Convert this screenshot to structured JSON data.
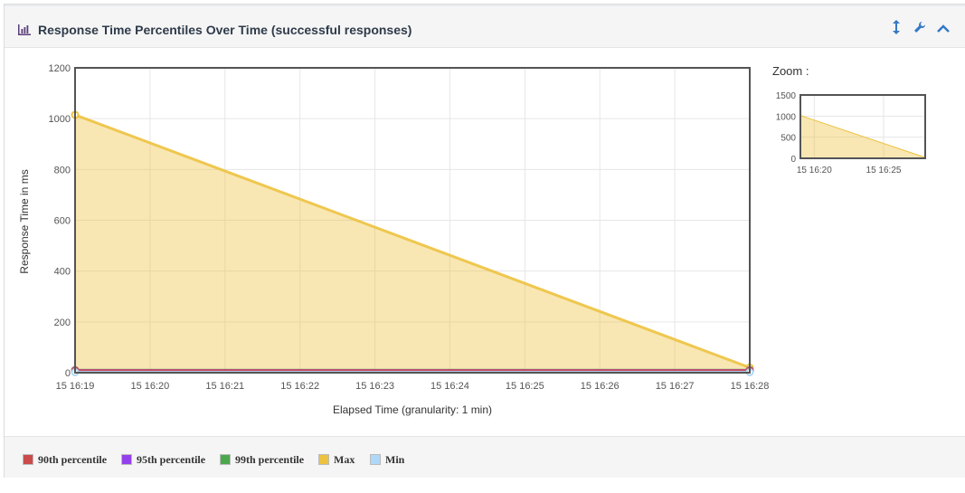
{
  "panel": {
    "title": "Response Time Percentiles Over Time (successful responses)",
    "icons": [
      "bar-chart-icon",
      "vertical-resize-icon",
      "wrench-icon",
      "chevron-up-icon"
    ]
  },
  "colors": {
    "90th": "#cb4b4b",
    "95th": "#9440ed",
    "99th": "#4da74d",
    "max": "#edc240",
    "min": "#afd8f8"
  },
  "chart_data": {
    "type": "area",
    "xlabel": "Elapsed Time (granularity: 1 min)",
    "ylabel": "Response Time in ms",
    "x": [
      "15 16:19",
      "15 16:28"
    ],
    "xticks": [
      "15 16:19",
      "15 16:20",
      "15 16:21",
      "15 16:22",
      "15 16:23",
      "15 16:24",
      "15 16:25",
      "15 16:26",
      "15 16:27",
      "15 16:28"
    ],
    "yticks": [
      0,
      200,
      400,
      600,
      800,
      1000,
      1200
    ],
    "ylim": [
      0,
      1200
    ],
    "grid": true,
    "legend_position": "bottom",
    "series": [
      {
        "name": "90th percentile",
        "color": "#cb4b4b",
        "values": [
          8,
          8
        ]
      },
      {
        "name": "95th percentile",
        "color": "#9440ed",
        "values": [
          9,
          9
        ]
      },
      {
        "name": "99th percentile",
        "color": "#4da74d",
        "values": [
          10,
          10
        ]
      },
      {
        "name": "Max",
        "color": "#edc240",
        "values": [
          1015,
          20
        ]
      },
      {
        "name": "Min",
        "color": "#afd8f8",
        "values": [
          2,
          2
        ]
      }
    ],
    "zoom": {
      "label": "Zoom :",
      "yticks": [
        0,
        500,
        1000,
        1500
      ],
      "xticks": [
        "15 16:20",
        "15 16:25"
      ],
      "ylim": [
        0,
        1500
      ]
    }
  }
}
